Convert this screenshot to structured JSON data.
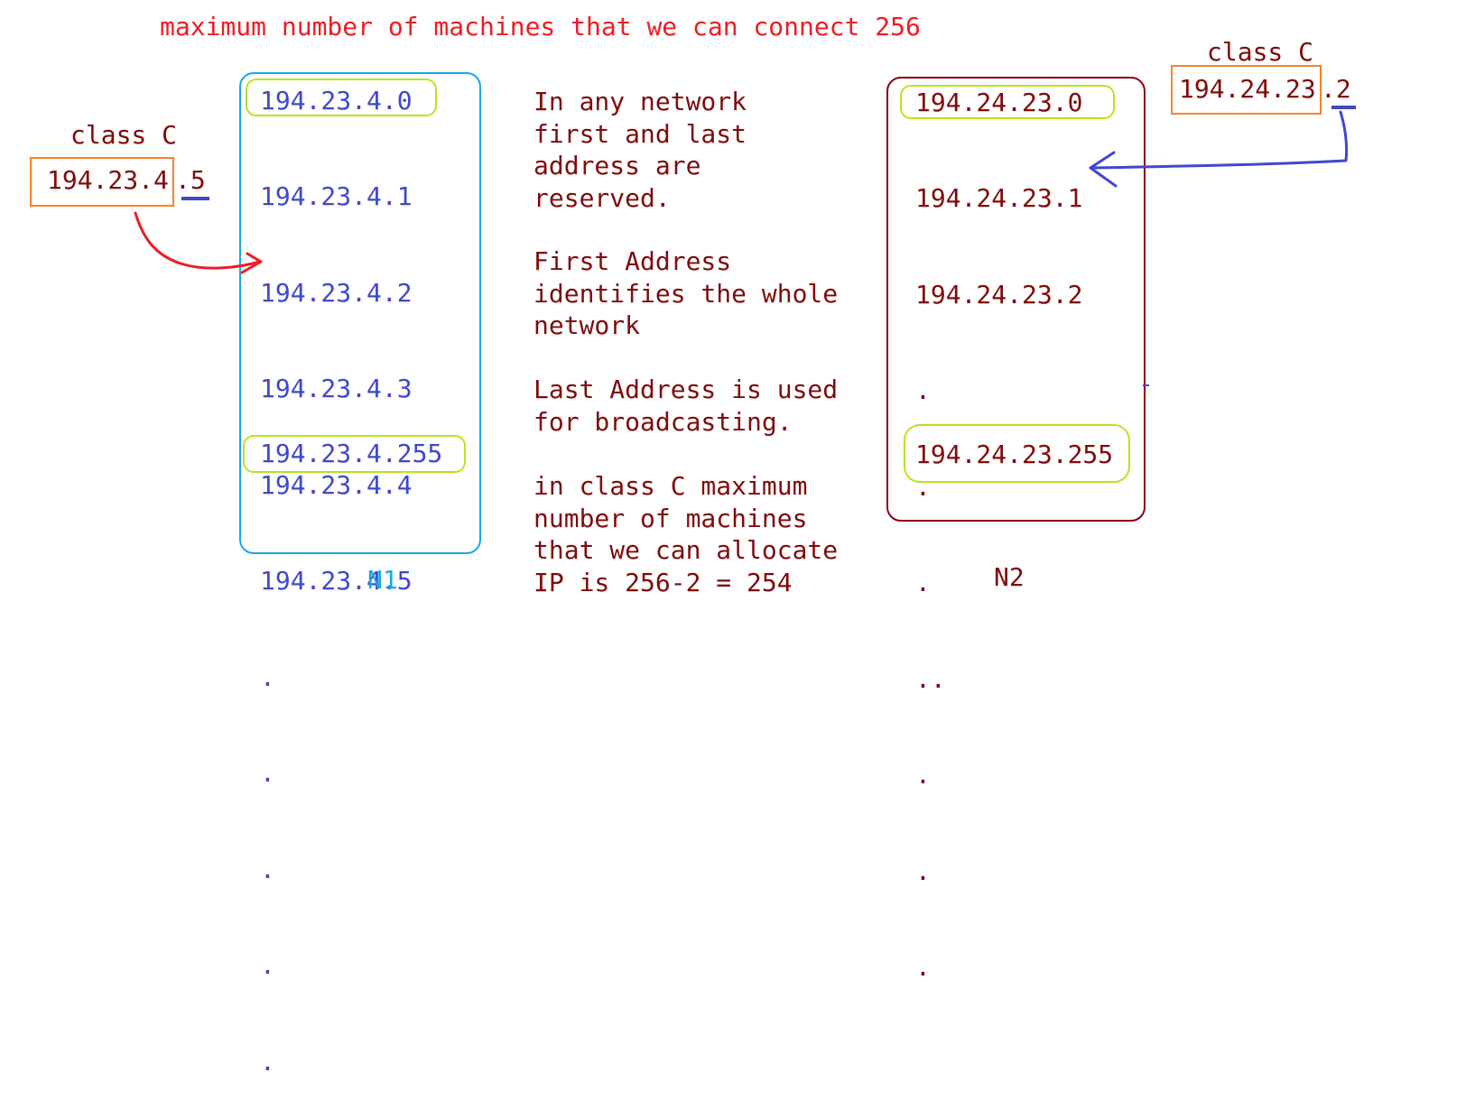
{
  "header": {
    "title": "maximum number of machines that we can connect 256"
  },
  "left_host": {
    "class_label": "class C",
    "address_prefix": "194.23.4",
    "host_part": ".5"
  },
  "right_host": {
    "class_label": "class C",
    "address_prefix": "194.24.23",
    "host_part": ".2"
  },
  "network_n1": {
    "label": "N1",
    "first_address": "194.23.4.0",
    "addresses": [
      "194.23.4.1",
      "194.23.4.2",
      "194.23.4.3",
      "194.23.4.4",
      "194.23.4.5",
      ".",
      ".",
      ".",
      ".",
      "."
    ],
    "last_address": "194.23.4.255"
  },
  "network_n2": {
    "label": "N2",
    "first_address": "194.24.23.0",
    "addresses": [
      "194.24.23.1",
      "194.24.23.2",
      ".",
      ".",
      ".",
      "..",
      ".",
      ".",
      "."
    ],
    "last_address": "194.24.23.255"
  },
  "notes": [
    "In any network\nfirst and last\naddress are\nreserved.",
    "First Address\nidentifies the whole\nnetwork",
    "Last Address is used\nfor broadcasting.",
    "in class C maximum\nnumber of machines\nthat we can allocate\nIP is 256-2 = 254"
  ],
  "colors": {
    "title": "#ee1c24",
    "text": "#7f0b0b",
    "n1_text": "#3f48cc",
    "n1_border": "#1aa6e8",
    "n2_border": "#880015",
    "host_box": "#ff7f27",
    "highlight": "#b5e61d",
    "left_arrow": "#ee1c24",
    "right_arrow": "#3f48cc"
  }
}
